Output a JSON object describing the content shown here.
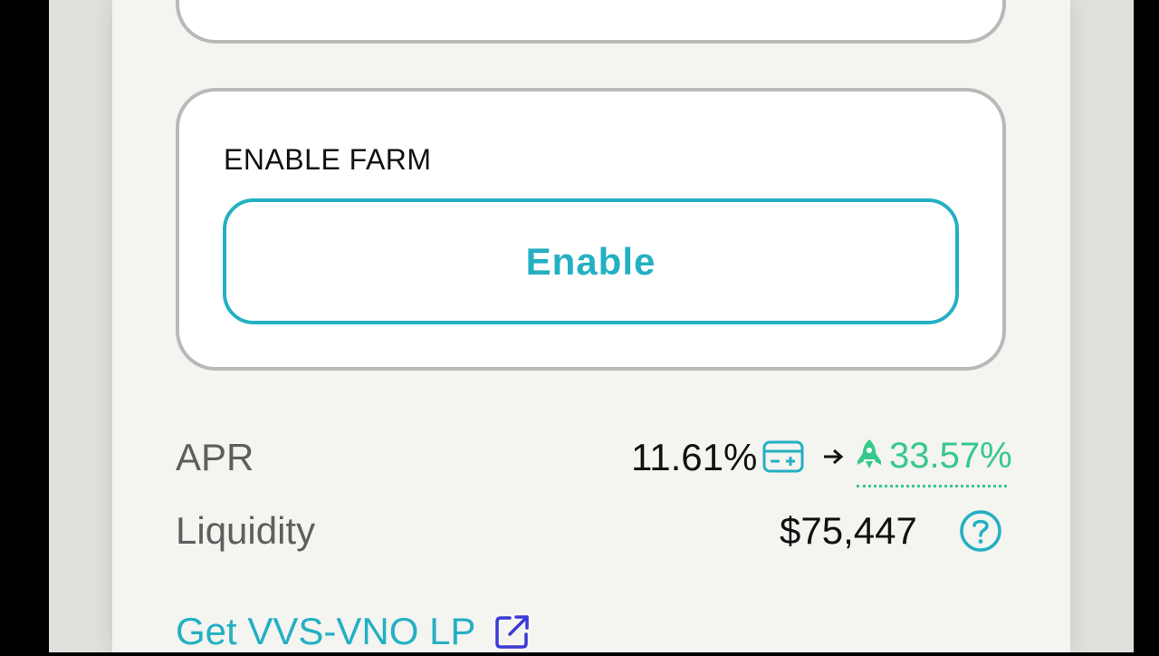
{
  "enable_farm": {
    "title": "ENABLE FARM",
    "button_label": "Enable"
  },
  "stats": {
    "apr_label": "APR",
    "apr_value": "11.61%",
    "apr_boosted": "33.57%",
    "liquidity_label": "Liquidity",
    "liquidity_value": "$75,447"
  },
  "link": {
    "label": "Get VVS-VNO LP"
  },
  "colors": {
    "accent": "#24b0c3",
    "boost_green": "#36c98a",
    "border_gray": "#b9b9b9",
    "panel_bg": "#f4f4f1"
  },
  "icons": {
    "calculator": "calculator-icon",
    "arrow": "arrow-right-icon",
    "rocket": "rocket-icon",
    "help": "question-circle-icon",
    "external": "external-link-icon"
  }
}
